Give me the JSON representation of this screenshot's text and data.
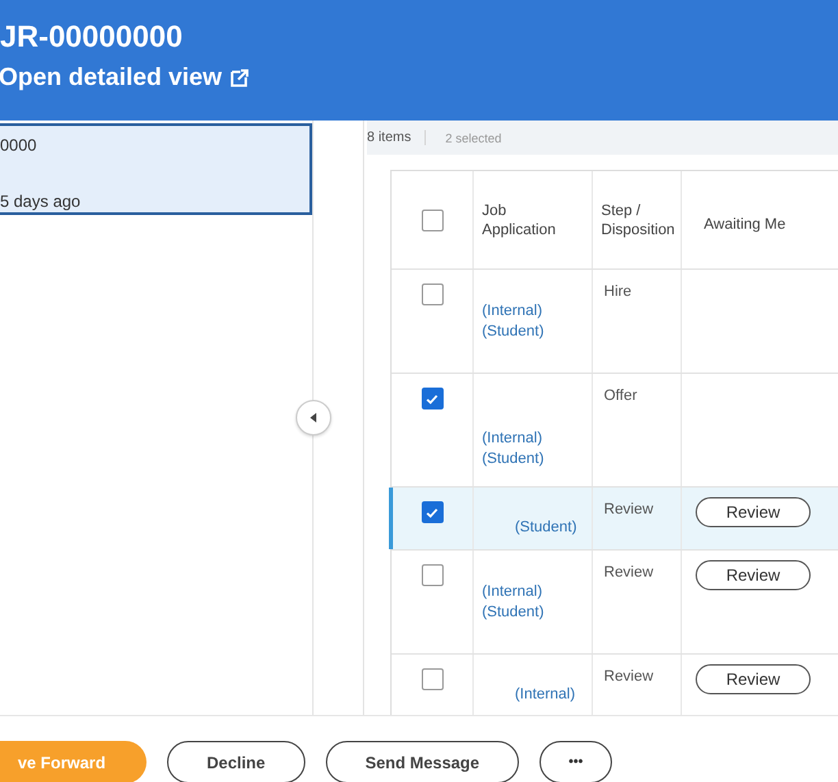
{
  "header": {
    "title": "JR-00000000",
    "link": "Open detailed view"
  },
  "left_panel": {
    "card": {
      "id": "0000",
      "age": "5 days ago",
      "selected": true
    }
  },
  "toolbar": {
    "count": "8 items",
    "selected_count": "2 selected"
  },
  "table": {
    "columns": [
      "Job Application",
      "Step / Disposition",
      "Awaiting Me"
    ],
    "header_checked": false,
    "rows": [
      {
        "checked": false,
        "selected": false,
        "job_lines": [
          "(Internal)",
          "(Student)"
        ],
        "step": "Hire"
      },
      {
        "checked": true,
        "selected": false,
        "job_lines": [
          "(Internal)",
          "(Student)"
        ],
        "step": "Offer"
      },
      {
        "checked": true,
        "selected": true,
        "job_lines": [
          "(Student)"
        ],
        "step": "Review",
        "action": "Review"
      },
      {
        "checked": false,
        "selected": false,
        "job_lines": [
          "(Internal)",
          "(Student)"
        ],
        "step": "Review",
        "action": "Review"
      },
      {
        "checked": false,
        "selected": false,
        "job_lines": [
          "(Internal)"
        ],
        "step": "Review",
        "action": "Review"
      }
    ]
  },
  "footer_buttons": [
    {
      "label": "ve Forward",
      "kind": "primary"
    },
    {
      "label": "Decline",
      "kind": "secondary"
    },
    {
      "label": "Send Message",
      "kind": "secondary"
    },
    {
      "label": "•••",
      "kind": "more"
    }
  ]
}
